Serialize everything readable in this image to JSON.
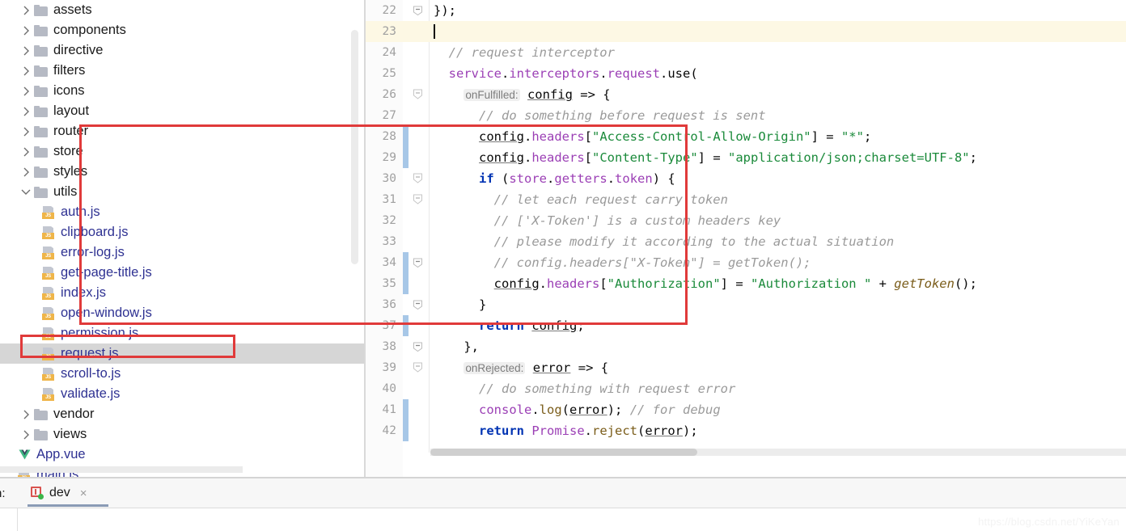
{
  "project_tree": {
    "name": "project-file-tree",
    "items": [
      {
        "label": "assets",
        "type": "folder",
        "indent": 1,
        "expanded": false,
        "arrow": "chevron-right",
        "selected": false
      },
      {
        "label": "components",
        "type": "folder",
        "indent": 1,
        "expanded": false,
        "arrow": "chevron-right",
        "selected": false
      },
      {
        "label": "directive",
        "type": "folder",
        "indent": 1,
        "expanded": false,
        "arrow": "chevron-right",
        "selected": false
      },
      {
        "label": "filters",
        "type": "folder",
        "indent": 1,
        "expanded": false,
        "arrow": "chevron-right",
        "selected": false
      },
      {
        "label": "icons",
        "type": "folder",
        "indent": 1,
        "expanded": false,
        "arrow": "chevron-right",
        "selected": false
      },
      {
        "label": "layout",
        "type": "folder",
        "indent": 1,
        "expanded": false,
        "arrow": "chevron-right",
        "selected": false
      },
      {
        "label": "router",
        "type": "folder",
        "indent": 1,
        "expanded": false,
        "arrow": "chevron-right",
        "selected": false
      },
      {
        "label": "store",
        "type": "folder",
        "indent": 1,
        "expanded": false,
        "arrow": "chevron-right",
        "selected": false
      },
      {
        "label": "styles",
        "type": "folder",
        "indent": 1,
        "expanded": false,
        "arrow": "chevron-right",
        "selected": false
      },
      {
        "label": "utils",
        "type": "folder",
        "indent": 1,
        "expanded": true,
        "arrow": "chevron-down",
        "selected": false
      },
      {
        "label": "auth.js",
        "type": "js",
        "indent": 2,
        "selected": false
      },
      {
        "label": "clipboard.js",
        "type": "js",
        "indent": 2,
        "selected": false
      },
      {
        "label": "error-log.js",
        "type": "js",
        "indent": 2,
        "selected": false
      },
      {
        "label": "get-page-title.js",
        "type": "js",
        "indent": 2,
        "selected": false
      },
      {
        "label": "index.js",
        "type": "js",
        "indent": 2,
        "selected": false
      },
      {
        "label": "open-window.js",
        "type": "js",
        "indent": 2,
        "selected": false
      },
      {
        "label": "permission.js",
        "type": "js",
        "indent": 2,
        "selected": false
      },
      {
        "label": "request.js",
        "type": "js",
        "indent": 2,
        "selected": true
      },
      {
        "label": "scroll-to.js",
        "type": "js",
        "indent": 2,
        "selected": false
      },
      {
        "label": "validate.js",
        "type": "js",
        "indent": 2,
        "selected": false
      },
      {
        "label": "vendor",
        "type": "folder",
        "indent": 1,
        "expanded": false,
        "arrow": "chevron-right",
        "selected": false
      },
      {
        "label": "views",
        "type": "folder",
        "indent": 1,
        "expanded": false,
        "arrow": "chevron-right",
        "selected": false
      },
      {
        "label": "App.vue",
        "type": "vue",
        "indent": 1,
        "selected": false
      },
      {
        "label": "main.js",
        "type": "js",
        "indent": 1,
        "selected": false
      }
    ]
  },
  "editor": {
    "name": "code-editor",
    "first_line_number": 22,
    "lines": [
      {
        "num": "22",
        "current": false,
        "fold": "collapse",
        "changebar": false,
        "tokens": [
          {
            "t": "});",
            "c": "tok-plain"
          }
        ]
      },
      {
        "num": "23",
        "current": true,
        "fold": "",
        "changebar": false,
        "caret": true,
        "tokens": []
      },
      {
        "num": "24",
        "current": false,
        "fold": "",
        "changebar": false,
        "tokens": [
          {
            "t": "  // request interceptor",
            "c": "tok-comment"
          }
        ]
      },
      {
        "num": "25",
        "current": false,
        "fold": "",
        "changebar": false,
        "tokens": [
          {
            "t": "  ",
            "c": "tok-plain"
          },
          {
            "t": "service",
            "c": "tok-prop"
          },
          {
            "t": ".",
            "c": "tok-plain"
          },
          {
            "t": "interceptors",
            "c": "tok-prop"
          },
          {
            "t": ".",
            "c": "tok-plain"
          },
          {
            "t": "request",
            "c": "tok-prop"
          },
          {
            "t": ".",
            "c": "tok-plain"
          },
          {
            "t": "use",
            "c": "tok-plain"
          },
          {
            "t": "(",
            "c": "tok-plain"
          }
        ]
      },
      {
        "num": "26",
        "current": false,
        "fold": "expand",
        "changebar": false,
        "tokens": [
          {
            "t": "    ",
            "c": "tok-plain"
          },
          {
            "t": "onFulfilled:",
            "c": "hint"
          },
          {
            "t": " ",
            "c": "tok-plain"
          },
          {
            "t": "config",
            "c": "tok-ident-u"
          },
          {
            "t": " => {",
            "c": "tok-plain"
          }
        ]
      },
      {
        "num": "27",
        "current": false,
        "fold": "",
        "changebar": false,
        "tokens": [
          {
            "t": "      // do something before request is sent",
            "c": "tok-comment"
          }
        ]
      },
      {
        "num": "28",
        "current": false,
        "fold": "",
        "changebar": true,
        "tokens": [
          {
            "t": "      ",
            "c": "tok-plain"
          },
          {
            "t": "config",
            "c": "tok-ident-u"
          },
          {
            "t": ".",
            "c": "tok-plain"
          },
          {
            "t": "headers",
            "c": "tok-prop"
          },
          {
            "t": "[",
            "c": "tok-plain"
          },
          {
            "t": "\"Access-Control-Allow-Origin\"",
            "c": "tok-string"
          },
          {
            "t": "] = ",
            "c": "tok-plain"
          },
          {
            "t": "\"*\"",
            "c": "tok-string"
          },
          {
            "t": ";",
            "c": "tok-plain"
          }
        ]
      },
      {
        "num": "29",
        "current": false,
        "fold": "",
        "changebar": true,
        "tokens": [
          {
            "t": "      ",
            "c": "tok-plain"
          },
          {
            "t": "config",
            "c": "tok-ident-u"
          },
          {
            "t": ".",
            "c": "tok-plain"
          },
          {
            "t": "headers",
            "c": "tok-prop"
          },
          {
            "t": "[",
            "c": "tok-plain"
          },
          {
            "t": "\"Content-Type\"",
            "c": "tok-string"
          },
          {
            "t": "] = ",
            "c": "tok-plain"
          },
          {
            "t": "\"application/json;charset=UTF-8\"",
            "c": "tok-string"
          },
          {
            "t": ";",
            "c": "tok-plain"
          }
        ]
      },
      {
        "num": "30",
        "current": false,
        "fold": "expand",
        "changebar": false,
        "tokens": [
          {
            "t": "      ",
            "c": "tok-plain"
          },
          {
            "t": "if",
            "c": "tok-keyword"
          },
          {
            "t": " (",
            "c": "tok-plain"
          },
          {
            "t": "store",
            "c": "tok-prop"
          },
          {
            "t": ".",
            "c": "tok-plain"
          },
          {
            "t": "getters",
            "c": "tok-prop"
          },
          {
            "t": ".",
            "c": "tok-plain"
          },
          {
            "t": "token",
            "c": "tok-prop"
          },
          {
            "t": ") {",
            "c": "tok-plain"
          }
        ]
      },
      {
        "num": "31",
        "current": false,
        "fold": "expand",
        "changebar": false,
        "tokens": [
          {
            "t": "        // let each request carry token",
            "c": "tok-comment"
          }
        ]
      },
      {
        "num": "32",
        "current": false,
        "fold": "",
        "changebar": false,
        "tokens": [
          {
            "t": "        // ['X-Token'] is a custom headers key",
            "c": "tok-comment"
          }
        ]
      },
      {
        "num": "33",
        "current": false,
        "fold": "",
        "changebar": false,
        "tokens": [
          {
            "t": "        // please modify it according to the actual situation",
            "c": "tok-comment"
          }
        ]
      },
      {
        "num": "34",
        "current": false,
        "fold": "collapse",
        "changebar": true,
        "tokens": [
          {
            "t": "        // config.headers[\"X-Token\"] = getToken();",
            "c": "tok-comment"
          }
        ]
      },
      {
        "num": "35",
        "current": false,
        "fold": "",
        "changebar": true,
        "tokens": [
          {
            "t": "        ",
            "c": "tok-plain"
          },
          {
            "t": "config",
            "c": "tok-ident-u"
          },
          {
            "t": ".",
            "c": "tok-plain"
          },
          {
            "t": "headers",
            "c": "tok-prop"
          },
          {
            "t": "[",
            "c": "tok-plain"
          },
          {
            "t": "\"Authorization\"",
            "c": "tok-string"
          },
          {
            "t": "] = ",
            "c": "tok-plain"
          },
          {
            "t": "\"Authorization \"",
            "c": "tok-string"
          },
          {
            "t": " + ",
            "c": "tok-plain"
          },
          {
            "t": "getToken",
            "c": "tok-func tok-italic"
          },
          {
            "t": "();",
            "c": "tok-plain"
          }
        ]
      },
      {
        "num": "36",
        "current": false,
        "fold": "collapse",
        "changebar": false,
        "tokens": [
          {
            "t": "      }",
            "c": "tok-plain"
          }
        ]
      },
      {
        "num": "37",
        "current": false,
        "fold": "",
        "changebar": true,
        "tokens": [
          {
            "t": "      ",
            "c": "tok-plain"
          },
          {
            "t": "return",
            "c": "tok-keyword"
          },
          {
            "t": " ",
            "c": "tok-plain"
          },
          {
            "t": "config",
            "c": "tok-ident-u"
          },
          {
            "t": ";",
            "c": "tok-plain"
          }
        ]
      },
      {
        "num": "38",
        "current": false,
        "fold": "collapse",
        "changebar": false,
        "tokens": [
          {
            "t": "    },",
            "c": "tok-plain"
          }
        ]
      },
      {
        "num": "39",
        "current": false,
        "fold": "expand",
        "changebar": false,
        "tokens": [
          {
            "t": "    ",
            "c": "tok-plain"
          },
          {
            "t": "onRejected:",
            "c": "hint"
          },
          {
            "t": " ",
            "c": "tok-plain"
          },
          {
            "t": "error",
            "c": "tok-ident-u"
          },
          {
            "t": " => {",
            "c": "tok-plain"
          }
        ]
      },
      {
        "num": "40",
        "current": false,
        "fold": "",
        "changebar": false,
        "tokens": [
          {
            "t": "      // do something with request error",
            "c": "tok-comment"
          }
        ]
      },
      {
        "num": "41",
        "current": false,
        "fold": "",
        "changebar": true,
        "tokens": [
          {
            "t": "      ",
            "c": "tok-plain"
          },
          {
            "t": "console",
            "c": "tok-prop"
          },
          {
            "t": ".",
            "c": "tok-plain"
          },
          {
            "t": "log",
            "c": "tok-func"
          },
          {
            "t": "(",
            "c": "tok-plain"
          },
          {
            "t": "error",
            "c": "tok-ident-u"
          },
          {
            "t": "); ",
            "c": "tok-plain"
          },
          {
            "t": "// for debug",
            "c": "tok-comment"
          }
        ]
      },
      {
        "num": "42",
        "current": false,
        "fold": "",
        "changebar": true,
        "tokens": [
          {
            "t": "      ",
            "c": "tok-plain"
          },
          {
            "t": "return",
            "c": "tok-keyword"
          },
          {
            "t": " ",
            "c": "tok-plain"
          },
          {
            "t": "Promise",
            "c": "tok-class"
          },
          {
            "t": ".",
            "c": "tok-plain"
          },
          {
            "t": "reject",
            "c": "tok-func"
          },
          {
            "t": "(",
            "c": "tok-plain"
          },
          {
            "t": "error",
            "c": "tok-ident-u"
          },
          {
            "t": ");",
            "c": "tok-plain"
          }
        ]
      }
    ]
  },
  "annotations": {
    "code_box_color": "#e03a3a",
    "tree_box_color": "#e03a3a"
  },
  "bottom_bar": {
    "run_label": "n:",
    "tab_name": "dev",
    "close_label": "×"
  },
  "watermark": {
    "text": "https://blog.csdn.net/YiKeYan"
  }
}
